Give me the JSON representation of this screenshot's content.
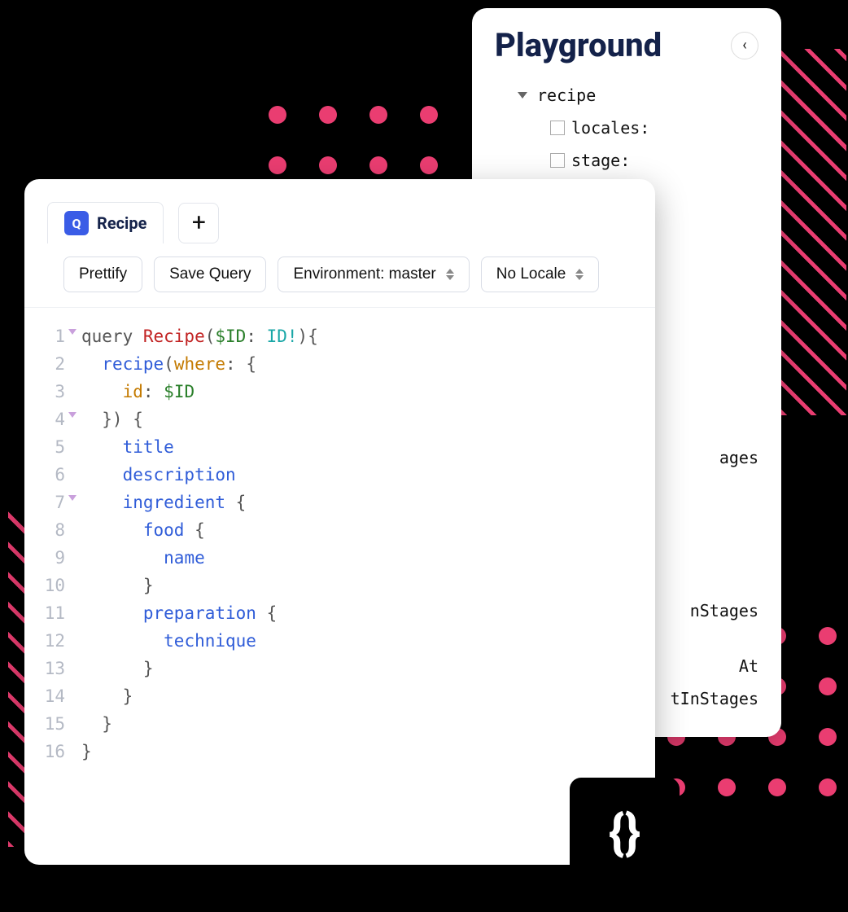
{
  "playground": {
    "title": "Playground",
    "tree": {
      "root": "recipe",
      "children": [
        {
          "label": "locales:"
        },
        {
          "label": "stage:"
        }
      ]
    },
    "extras": [
      "ages",
      "nStages",
      "At",
      "tInStages"
    ]
  },
  "editor": {
    "tab": {
      "badge": "Q",
      "label": "Recipe"
    },
    "toolbar": {
      "prettify": "Prettify",
      "save": "Save Query",
      "env": "Environment: master",
      "locale": "No Locale"
    },
    "code": [
      {
        "n": 1,
        "fold": true,
        "tokens": [
          [
            "punc",
            "query "
          ],
          [
            "key",
            "Recipe"
          ],
          [
            "punc",
            "("
          ],
          [
            "var",
            "$ID"
          ],
          [
            "punc",
            ": "
          ],
          [
            "type",
            "ID!"
          ],
          [
            "punc",
            "){"
          ]
        ]
      },
      {
        "n": 2,
        "fold": false,
        "tokens": [
          [
            "punc",
            "  "
          ],
          [
            "field",
            "recipe"
          ],
          [
            "punc",
            "("
          ],
          [
            "arg",
            "where"
          ],
          [
            "punc",
            ": {"
          ]
        ]
      },
      {
        "n": 3,
        "fold": false,
        "tokens": [
          [
            "punc",
            "    "
          ],
          [
            "arg",
            "id"
          ],
          [
            "punc",
            ": "
          ],
          [
            "var",
            "$ID"
          ]
        ]
      },
      {
        "n": 4,
        "fold": true,
        "tokens": [
          [
            "punc",
            "  }) {"
          ]
        ]
      },
      {
        "n": 5,
        "fold": false,
        "tokens": [
          [
            "punc",
            "    "
          ],
          [
            "field",
            "title"
          ]
        ]
      },
      {
        "n": 6,
        "fold": false,
        "tokens": [
          [
            "punc",
            "    "
          ],
          [
            "field",
            "description"
          ]
        ]
      },
      {
        "n": 7,
        "fold": true,
        "tokens": [
          [
            "punc",
            "    "
          ],
          [
            "field",
            "ingredient"
          ],
          [
            "punc",
            " {"
          ]
        ]
      },
      {
        "n": 8,
        "fold": false,
        "tokens": [
          [
            "punc",
            "      "
          ],
          [
            "field",
            "food"
          ],
          [
            "punc",
            " {"
          ]
        ]
      },
      {
        "n": 9,
        "fold": false,
        "tokens": [
          [
            "punc",
            "        "
          ],
          [
            "field",
            "name"
          ]
        ]
      },
      {
        "n": 10,
        "fold": false,
        "tokens": [
          [
            "punc",
            "      }"
          ]
        ]
      },
      {
        "n": 11,
        "fold": false,
        "tokens": [
          [
            "punc",
            "      "
          ],
          [
            "field",
            "preparation"
          ],
          [
            "punc",
            " {"
          ]
        ]
      },
      {
        "n": 12,
        "fold": false,
        "tokens": [
          [
            "punc",
            "        "
          ],
          [
            "field",
            "technique"
          ]
        ]
      },
      {
        "n": 13,
        "fold": false,
        "tokens": [
          [
            "punc",
            "      }"
          ]
        ]
      },
      {
        "n": 14,
        "fold": false,
        "tokens": [
          [
            "punc",
            "    }"
          ]
        ]
      },
      {
        "n": 15,
        "fold": false,
        "tokens": [
          [
            "punc",
            "  }"
          ]
        ]
      },
      {
        "n": 16,
        "fold": false,
        "tokens": [
          [
            "punc",
            "}"
          ]
        ]
      }
    ]
  },
  "badge": {
    "glyph": "{}"
  }
}
